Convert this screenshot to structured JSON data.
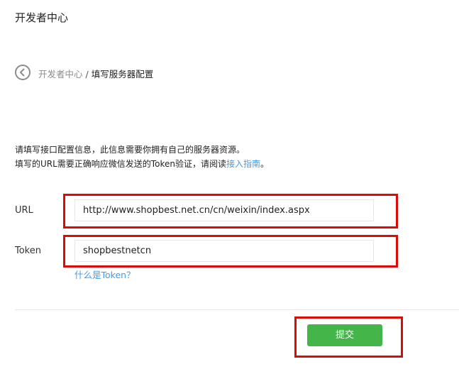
{
  "header": {
    "title": "开发者中心"
  },
  "breadcrumb": {
    "back_icon": "chevron-left-circle-icon",
    "parent": "开发者中心",
    "separator": " / ",
    "current": "填写服务器配置"
  },
  "intro": {
    "line1": "请填写接口配置信息，此信息需要你拥有自己的服务器资源。",
    "line2_prefix": "填写的URL需要正确响应微信发送的Token验证，请阅读",
    "line2_link": "接入指南",
    "line2_suffix": "。"
  },
  "form": {
    "url_label": "URL",
    "url_value": "http://www.shopbest.net.cn/cn/weixin/index.aspx",
    "token_label": "Token",
    "token_value": "shopbestnetcn",
    "token_help": "什么是Token？"
  },
  "actions": {
    "submit_label": "提交"
  },
  "colors": {
    "accent_link": "#459ae9",
    "submit_green": "#44b549",
    "highlight_red": "#dd0a0a"
  }
}
